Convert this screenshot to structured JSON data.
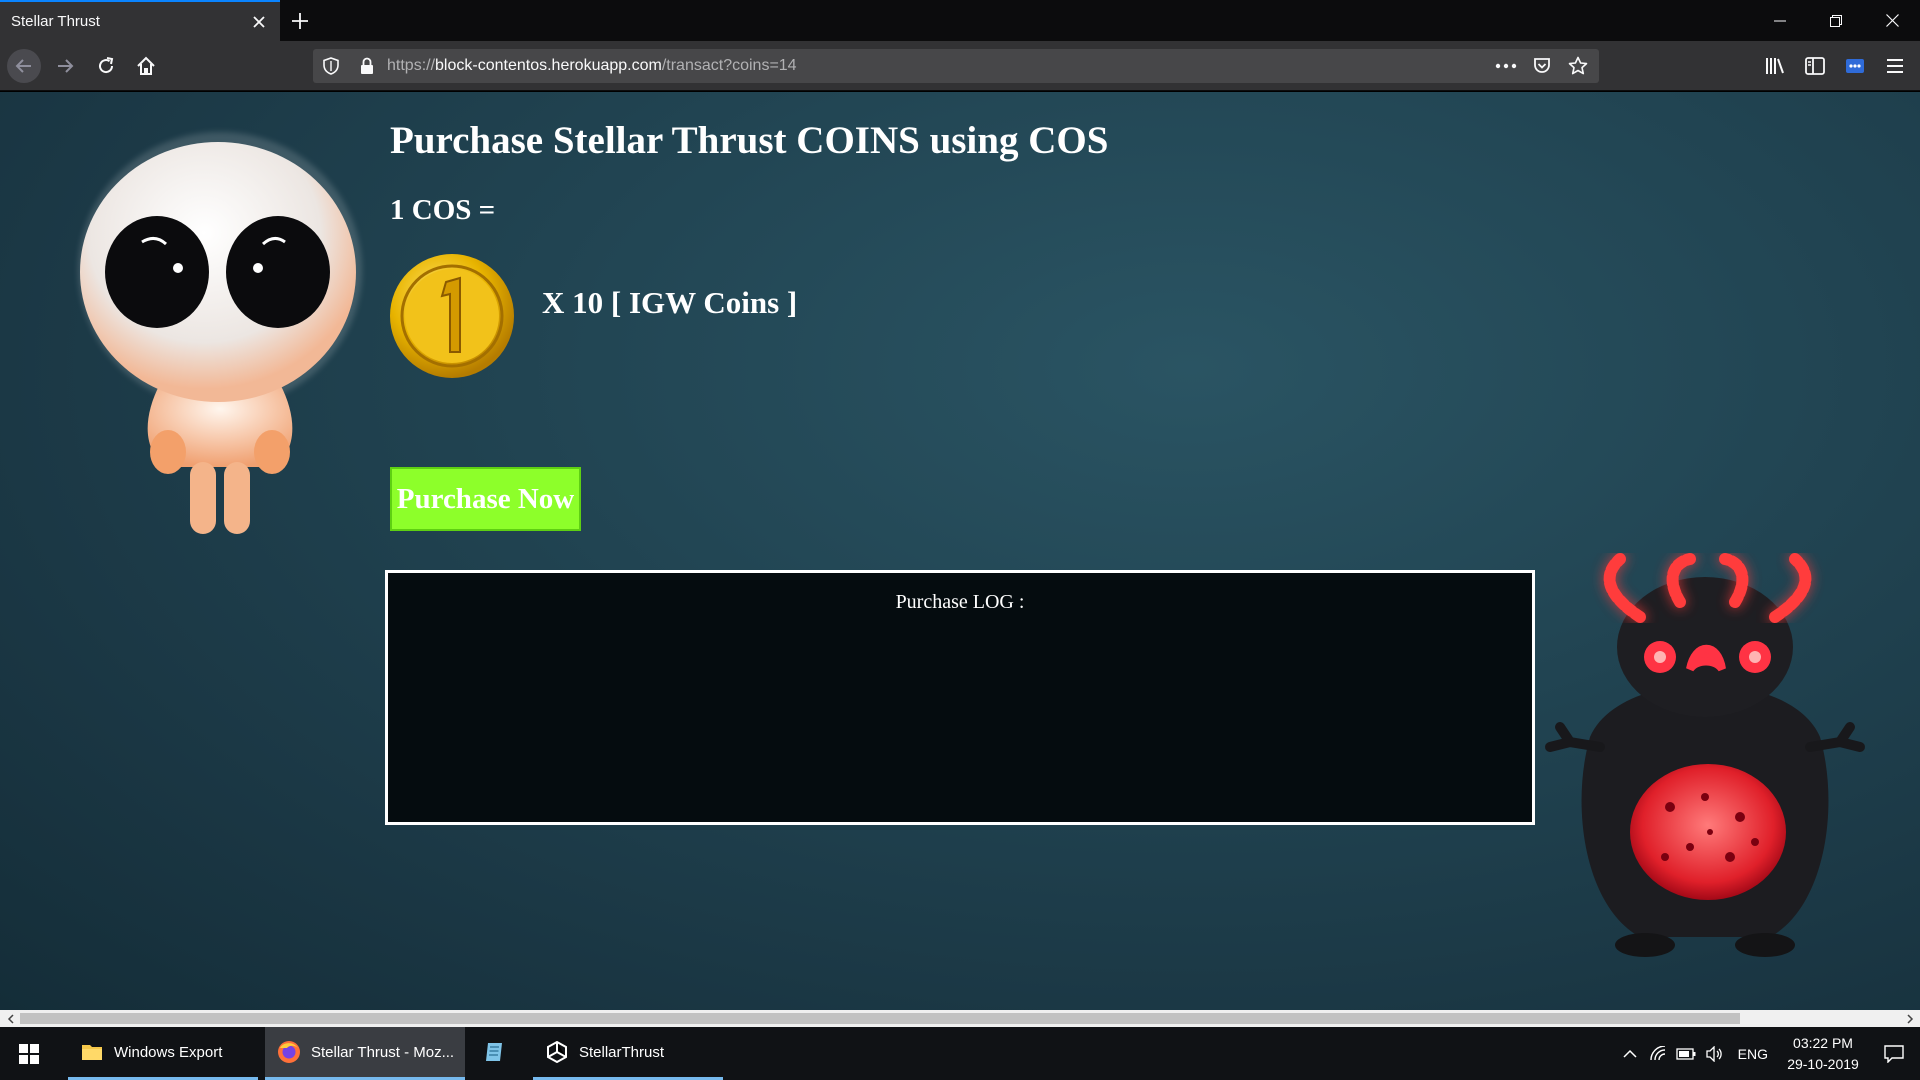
{
  "browser": {
    "tab_title": "Stellar Thrust",
    "url_prefix": "https://",
    "url_host": "block-contentos.herokuapp.com",
    "url_path": "/transact?coins=14",
    "accent_color": "#0a84ff"
  },
  "page": {
    "title": "Purchase Stellar Thrust COINS using COS",
    "rate_label": "1 COS =",
    "multiplier_label": "X 10 [ IGW Coins ]",
    "purchase_button": "Purchase Now",
    "purchase_button_color": "#8dff2a",
    "log_title": "Purchase LOG :",
    "coin_icon": "gold-coin-icon"
  },
  "taskbar": {
    "apps": [
      {
        "label": "Windows Export",
        "icon": "folder-icon"
      },
      {
        "label": "Stellar Thrust - Moz...",
        "icon": "firefox-icon"
      },
      {
        "label": "",
        "icon": "notepad-icon"
      },
      {
        "label": "StellarThrust",
        "icon": "unity-icon"
      }
    ],
    "language": "ENG",
    "time": "03:22 PM",
    "date": "29-10-2019"
  }
}
